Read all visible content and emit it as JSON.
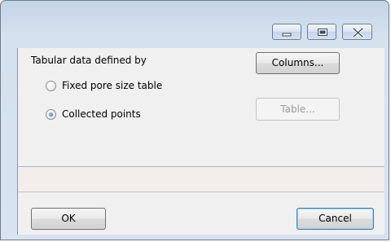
{
  "window": {
    "controls": {
      "minimize_icon": "minimize-icon",
      "maximize_icon": "maximize-icon",
      "close_icon": "close-icon"
    }
  },
  "tabular": {
    "group_label": "Tabular data defined by",
    "options": [
      {
        "label": "Fixed pore size table",
        "selected": false
      },
      {
        "label": "Collected points",
        "selected": true
      }
    ],
    "columns_button": "Columns...",
    "table_button": "Table...",
    "table_button_enabled": false
  },
  "footer": {
    "ok_label": "OK",
    "cancel_label": "Cancel"
  }
}
